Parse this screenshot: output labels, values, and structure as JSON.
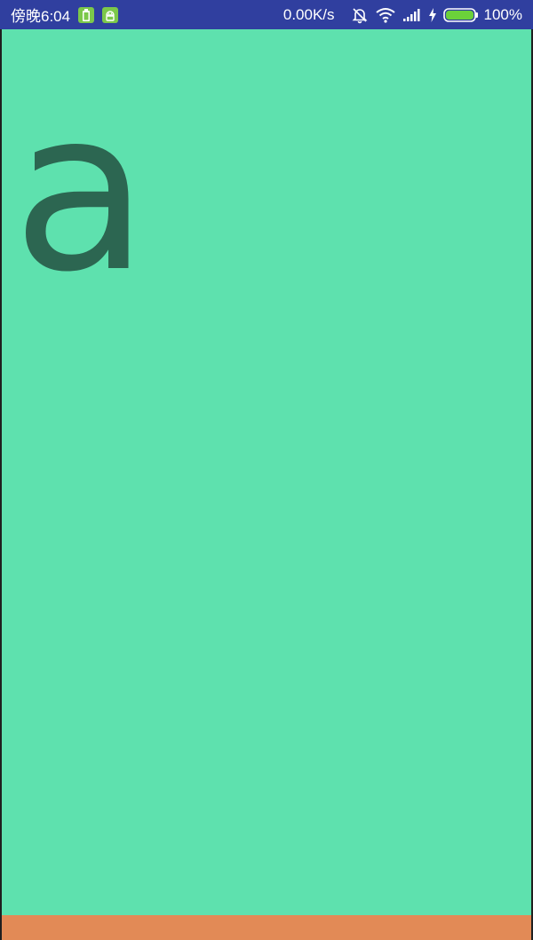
{
  "status_bar": {
    "time": "傍晚6:04",
    "network_speed": "0.00K/s",
    "battery_percent": "100%",
    "battery_level": 1.0,
    "colors": {
      "background": "#303F9F",
      "text": "#FFFFFF",
      "notif_icon": "#7CC84A",
      "battery_fill": "#6BD13A"
    },
    "icons": [
      "battery-notification-icon",
      "android-notification-icon",
      "alarm-off-icon",
      "wifi-icon",
      "signal-icon",
      "charging-icon",
      "battery-icon"
    ]
  },
  "main": {
    "letter": "a",
    "colors": {
      "background": "#5EE1AE",
      "letter": "#2C6651"
    }
  },
  "bottom_bar": {
    "colors": {
      "background": "#E28A56"
    }
  }
}
